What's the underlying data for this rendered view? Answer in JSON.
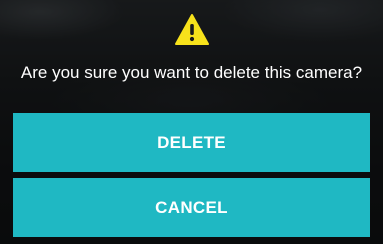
{
  "dialog": {
    "icon": "warning-icon",
    "message": "Are you sure you want to delete this camera?",
    "delete_label": "DELETE",
    "cancel_label": "CANCEL"
  },
  "colors": {
    "button": "#1fb8c3",
    "icon": "#f7e21b",
    "text": "#ffffff"
  }
}
